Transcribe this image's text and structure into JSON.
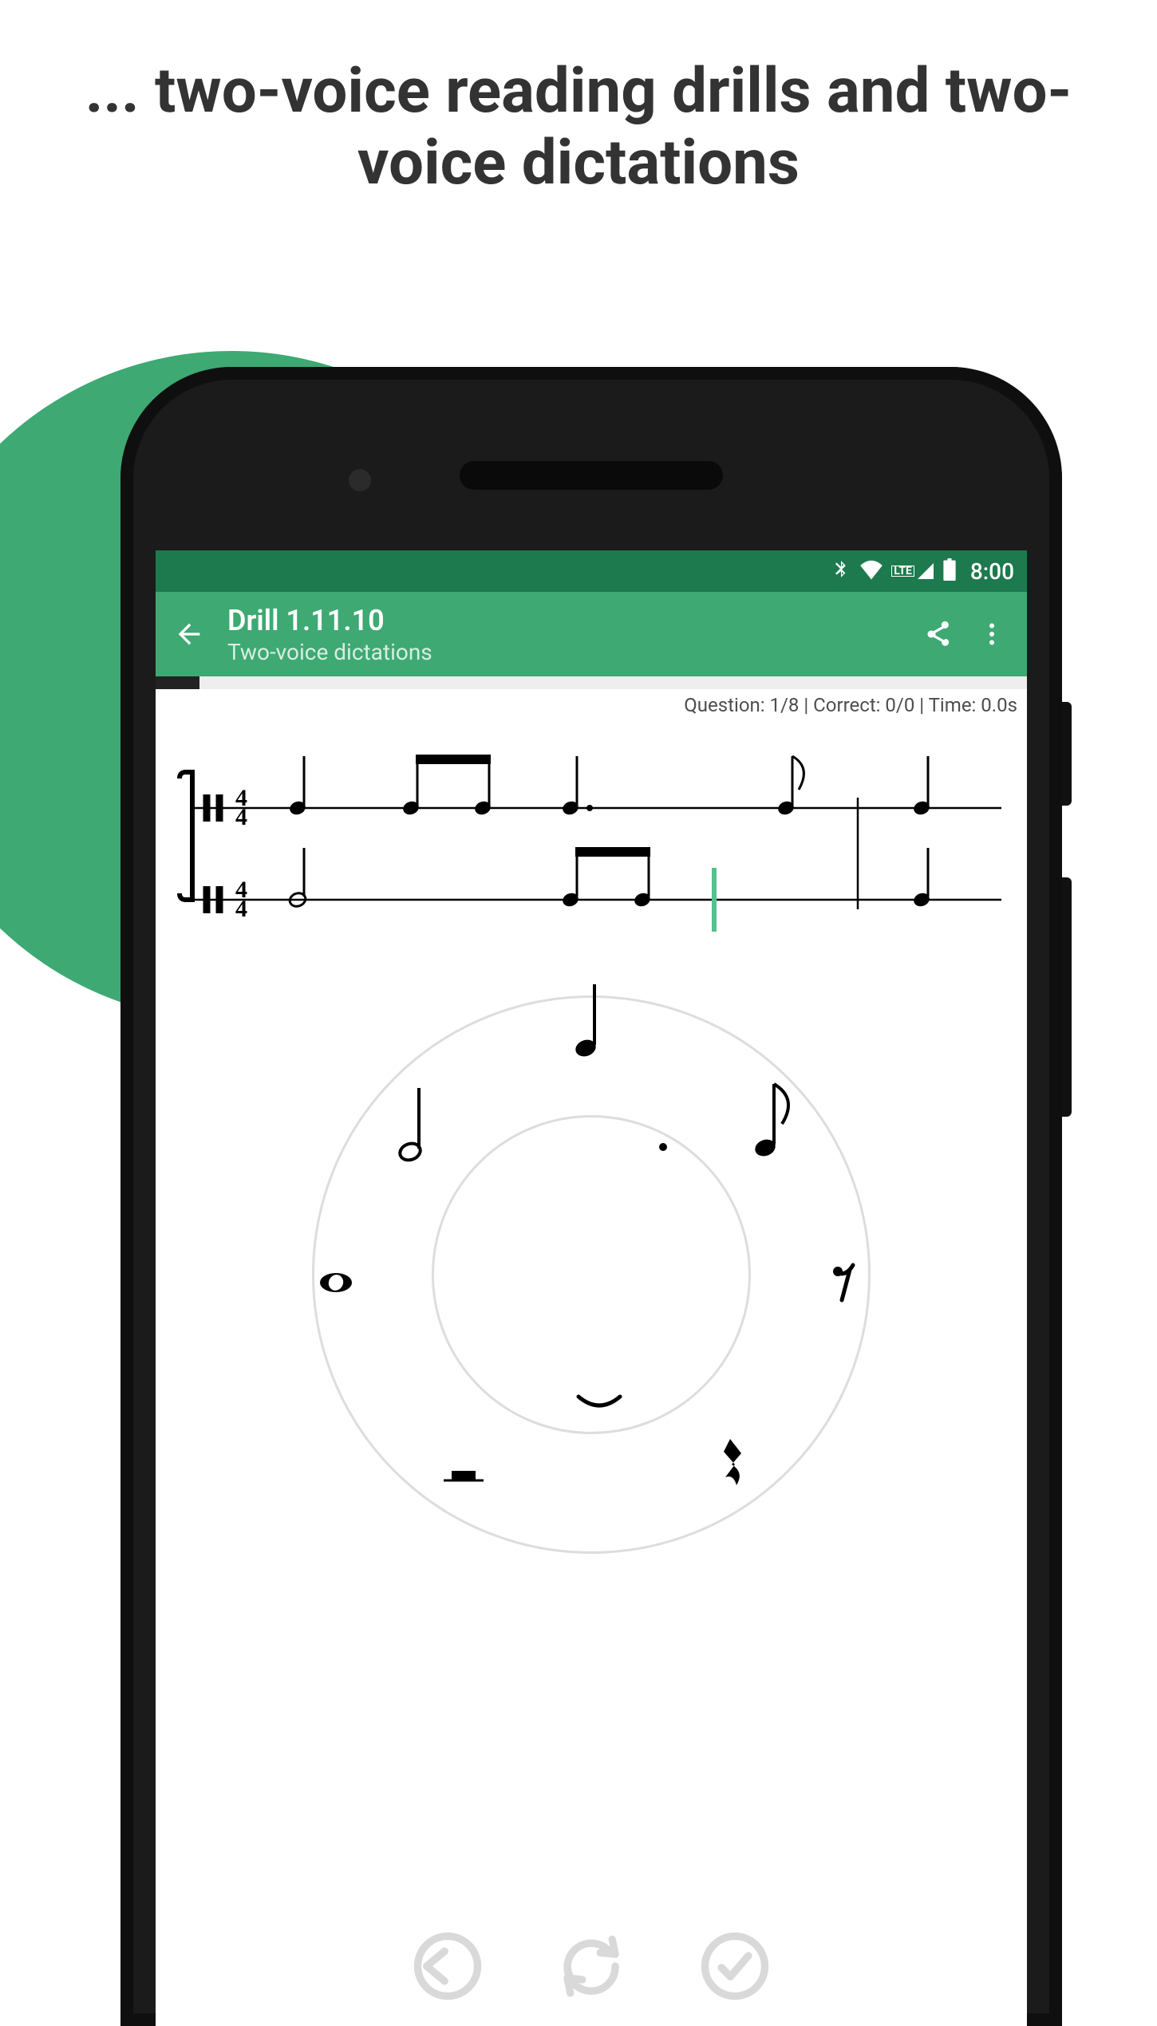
{
  "promo": {
    "headline": "... two-voice reading drills and two-voice dictations"
  },
  "status_bar": {
    "bluetooth_icon": "bluetooth",
    "wifi_icon": "wifi",
    "cell_label": "LTE",
    "cell_icon": "cellular",
    "battery_icon": "battery",
    "time": "8:00"
  },
  "app_bar": {
    "back_icon": "arrow-back",
    "title": "Drill 1.11.10",
    "subtitle": "Two-voice dictations",
    "share_icon": "share",
    "more_icon": "more-vert"
  },
  "progress": {
    "done": 1,
    "total": 20
  },
  "stats": {
    "question_current": 1,
    "question_total": 8,
    "correct_done": 0,
    "correct_total": 0,
    "time_seconds": "0.0s",
    "text": "Question: 1/8 | Correct: 0/0 | Time: 0.0s"
  },
  "notation": {
    "time_signature": {
      "top": "4",
      "bottom": "4"
    },
    "voice1": [
      "quarter",
      "beamed-eighths",
      "dotted-quarter",
      "single-eighth",
      "barline",
      "quarter"
    ],
    "voice2": [
      "half",
      "beamed-eighths",
      "cursor",
      "barline",
      "quarter"
    ]
  },
  "note_picker": {
    "options": [
      {
        "id": "quarter",
        "label": "quarter-note"
      },
      {
        "id": "eighth",
        "label": "eighth-note"
      },
      {
        "id": "eighth-rest",
        "label": "eighth-rest"
      },
      {
        "id": "quarter-rest",
        "label": "quarter-rest"
      },
      {
        "id": "half-rest",
        "label": "half-rest"
      },
      {
        "id": "whole",
        "label": "whole-note"
      },
      {
        "id": "half",
        "label": "half-note"
      },
      {
        "id": "dot",
        "label": "dot"
      },
      {
        "id": "tie",
        "label": "tie"
      }
    ]
  },
  "bottom_actions": {
    "undo": "undo",
    "replay": "replay",
    "confirm": "confirm"
  }
}
